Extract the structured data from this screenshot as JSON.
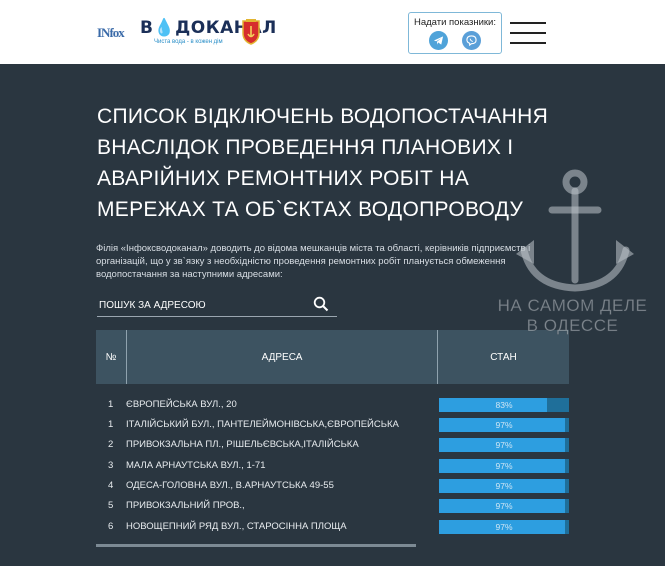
{
  "header": {
    "logo_infox": "INfox",
    "logo_vodokanal_prefix": "В",
    "logo_vodokanal_drop": "◆",
    "logo_vodokanal_suffix": "ДОКАНАЛ",
    "logo_slogan": "Чиста вода - в кожен дім",
    "reading_label": "Надати показники:",
    "telegram_icon": "telegram-icon",
    "viber_icon": "viber-icon",
    "menu_icon": "hamburger-menu-icon"
  },
  "title": "СПИСОК ВІДКЛЮЧЕНЬ ВОДОПОСТАЧАННЯ ВНАСЛІДОК ПРОВЕДЕННЯ ПЛАНОВИХ І АВАРІЙНИХ РЕМОНТНИХ РОБІТ НА МЕРЕЖАХ ТА ОБ`ЄКТАХ ВОДОПРОВОДУ",
  "intro": "Філія «Інфоксводоканал» доводить до відома мешканців міста та області, керівників підприємств і організацій, що у зв`язку з необхідністю проведення ремонтних робіт планується обмеження водопостачання за наступними адресами:",
  "search": {
    "placeholder": "ПОШУК ЗА АДРЕСОЮ",
    "value": ""
  },
  "table": {
    "headers": {
      "num": "№",
      "address": "АДРЕСА",
      "status": "СТАН"
    },
    "rows": [
      {
        "num": "1",
        "address": "ЄВРОПЕЙСЬКА ВУЛ., 20",
        "status": "83%",
        "progress": 0.83
      },
      {
        "num": "1",
        "address": "ІТАЛІЙСЬКИЙ БУЛ., ПАНТЕЛЕЙМОНІВСЬКА,ЄВРОПЕЙСЬКА",
        "status": "97%",
        "progress": 0.97
      },
      {
        "num": "2",
        "address": "ПРИВОКЗАЛЬНА ПЛ., РІШЕЛЬЄВСЬКА,ІТАЛІЙСЬКА",
        "status": "97%",
        "progress": 0.97
      },
      {
        "num": "3",
        "address": "МАЛА АРНАУТСЬКА ВУЛ., 1-71",
        "status": "97%",
        "progress": 0.97
      },
      {
        "num": "4",
        "address": "ОДЕСА-ГОЛОВНА ВУЛ., В.АРНАУТСЬКА 49-55",
        "status": "97%",
        "progress": 0.97
      },
      {
        "num": "5",
        "address": "ПРИВОКЗАЛЬНИЙ ПРОВ.,",
        "status": "97%",
        "progress": 0.97
      },
      {
        "num": "6",
        "address": "НОВОЩЕПНИЙ РЯД ВУЛ., СТАРОСІННА ПЛОЩА",
        "status": "97%",
        "progress": 0.97
      }
    ]
  },
  "watermark": {
    "line1": "НА САМОМ ДЕЛЕ",
    "line2": "В ОДЕССЕ",
    "icon": "anchor-icon"
  },
  "colors": {
    "background": "#2a3640",
    "table_header": "#3d5361",
    "progress_fill": "#2d9ee0"
  }
}
